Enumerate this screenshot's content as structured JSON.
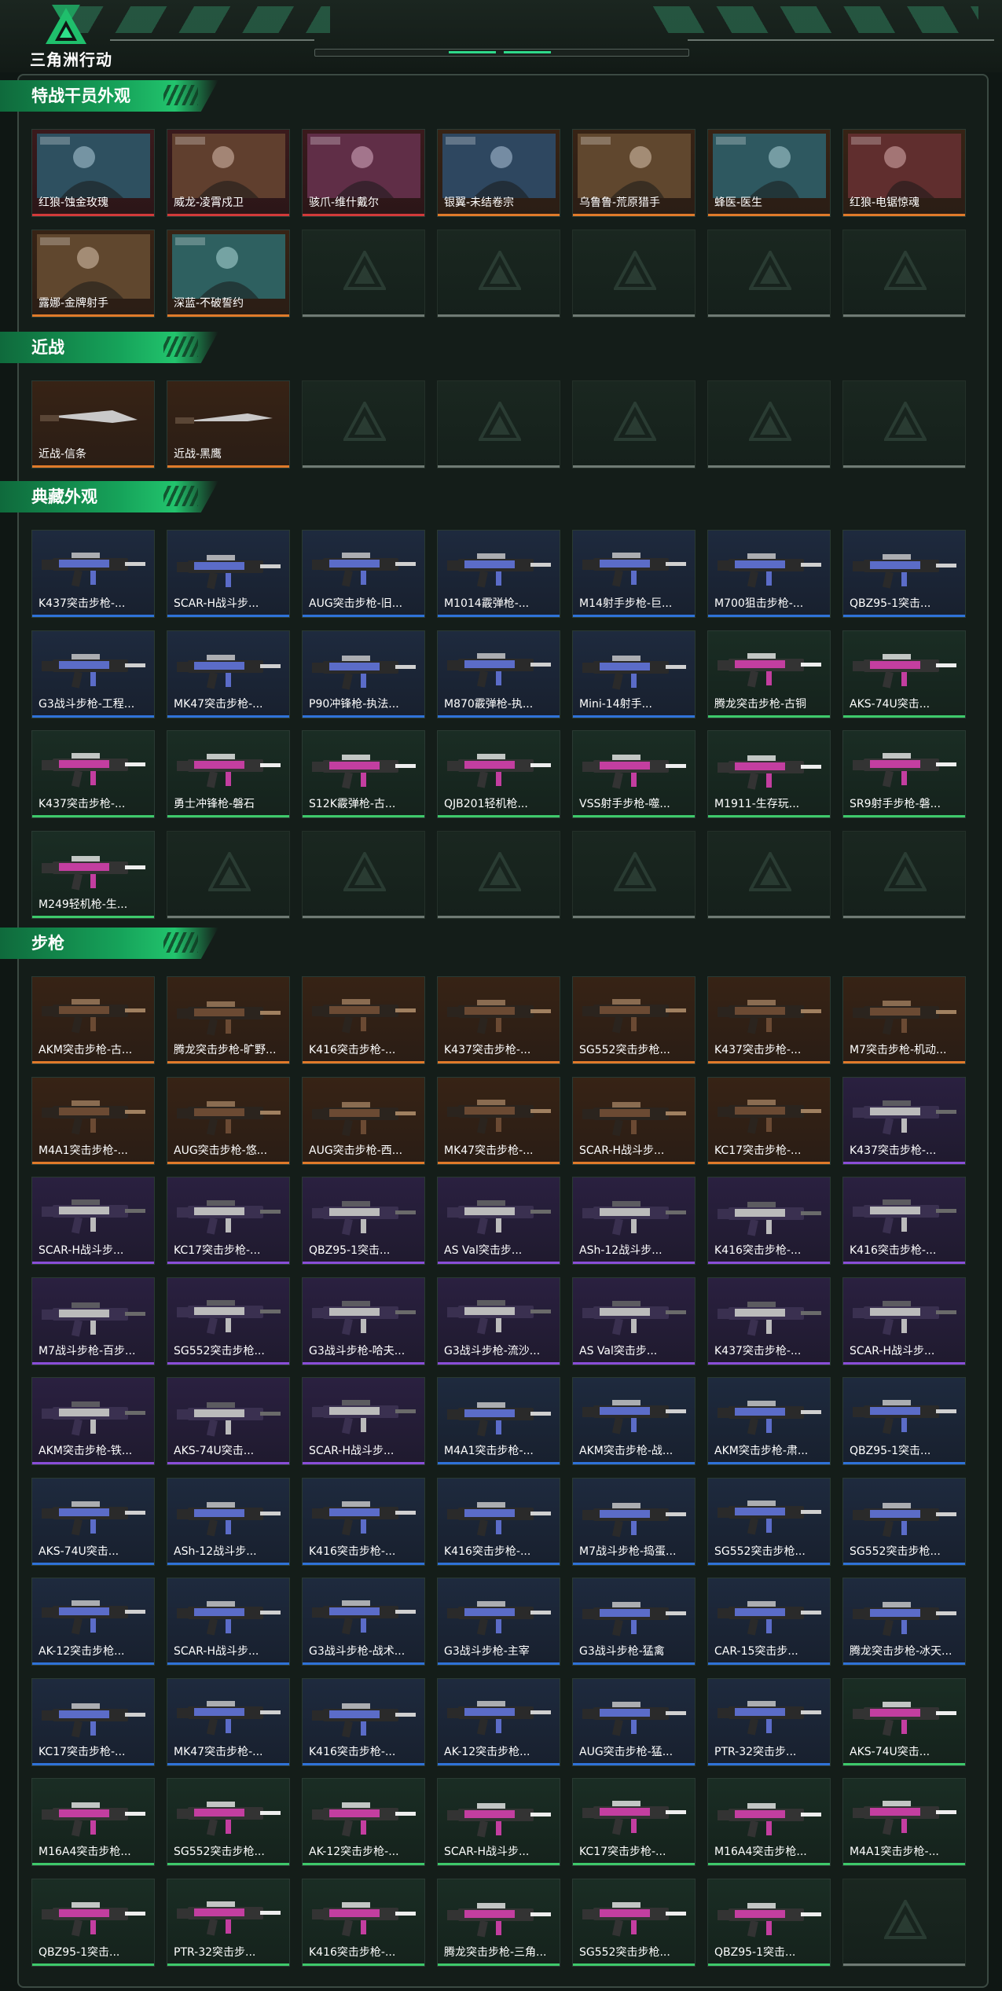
{
  "header": {
    "logo_text": "三角洲行动"
  },
  "colors": {
    "accent": "#22c46d",
    "gold": "#e07a2a",
    "red": "#d23a3a",
    "purple": "#8a4ed8",
    "blue": "#2f72d8",
    "green": "#3ec96b"
  },
  "sections": [
    {
      "title": "特战干员外观",
      "items": [
        {
          "name": "红狼-蚀金玫瑰",
          "rarity": "red"
        },
        {
          "name": "威龙-凌霄戍卫",
          "rarity": "red"
        },
        {
          "name": "骇爪-维什戴尔",
          "rarity": "red"
        },
        {
          "name": "银翼-未结卷宗",
          "rarity": "gold"
        },
        {
          "name": "乌鲁鲁-荒原猎手",
          "rarity": "gold"
        },
        {
          "name": "蜂医-医生",
          "rarity": "gold"
        },
        {
          "name": "红狼-电锯惊魂",
          "rarity": "gold"
        },
        {
          "name": "露娜-金牌射手",
          "rarity": "gold"
        },
        {
          "name": "深蓝-不破誓约",
          "rarity": "gold"
        }
      ],
      "empty_slots": 5
    },
    {
      "title": "近战",
      "items": [
        {
          "name": "近战-信条",
          "rarity": "gold"
        },
        {
          "name": "近战-黑鹰",
          "rarity": "gold"
        }
      ],
      "empty_slots": 5
    },
    {
      "title": "典藏外观",
      "items": [
        {
          "name": "K437突击步枪-...",
          "rarity": "blue"
        },
        {
          "name": "SCAR-H战斗步...",
          "rarity": "blue"
        },
        {
          "name": "AUG突击步枪-旧...",
          "rarity": "blue"
        },
        {
          "name": "M1014霰弹枪-...",
          "rarity": "blue"
        },
        {
          "name": "M14射手步枪-巨...",
          "rarity": "blue"
        },
        {
          "name": "M700狙击步枪-...",
          "rarity": "blue"
        },
        {
          "name": "QBZ95-1突击...",
          "rarity": "blue"
        },
        {
          "name": "G3战斗步枪-工程...",
          "rarity": "blue"
        },
        {
          "name": "MK47突击步枪-...",
          "rarity": "blue"
        },
        {
          "name": "P90冲锋枪-执法...",
          "rarity": "blue"
        },
        {
          "name": "M870霰弹枪-执...",
          "rarity": "blue"
        },
        {
          "name": "Mini-14射手...",
          "rarity": "blue"
        },
        {
          "name": "腾龙突击步枪-古铜",
          "rarity": "green"
        },
        {
          "name": "AKS-74U突击...",
          "rarity": "green"
        },
        {
          "name": "K437突击步枪-...",
          "rarity": "green"
        },
        {
          "name": "勇士冲锋枪-磐石",
          "rarity": "green"
        },
        {
          "name": "S12K霰弹枪-古...",
          "rarity": "green"
        },
        {
          "name": "QJB201轻机枪...",
          "rarity": "green"
        },
        {
          "name": "VSS射手步枪-噬...",
          "rarity": "green"
        },
        {
          "name": "M1911-生存玩...",
          "rarity": "green"
        },
        {
          "name": "SR9射手步枪-磐...",
          "rarity": "green"
        },
        {
          "name": "M249轻机枪-生...",
          "rarity": "green"
        }
      ],
      "empty_slots": 6
    },
    {
      "title": "步枪",
      "items": [
        {
          "name": "AKM突击步枪-古...",
          "rarity": "gold"
        },
        {
          "name": "腾龙突击步枪-旷野...",
          "rarity": "gold"
        },
        {
          "name": "K416突击步枪-...",
          "rarity": "gold"
        },
        {
          "name": "K437突击步枪-...",
          "rarity": "gold"
        },
        {
          "name": "SG552突击步枪...",
          "rarity": "gold"
        },
        {
          "name": "K437突击步枪-...",
          "rarity": "gold"
        },
        {
          "name": "M7突击步枪-机动...",
          "rarity": "gold"
        },
        {
          "name": "M4A1突击步枪-...",
          "rarity": "gold"
        },
        {
          "name": "AUG突击步枪-悠...",
          "rarity": "gold"
        },
        {
          "name": "AUG突击步枪-西...",
          "rarity": "gold"
        },
        {
          "name": "MK47突击步枪-...",
          "rarity": "gold"
        },
        {
          "name": "SCAR-H战斗步...",
          "rarity": "gold"
        },
        {
          "name": "KC17突击步枪-...",
          "rarity": "gold"
        },
        {
          "name": "K437突击步枪-...",
          "rarity": "purple"
        },
        {
          "name": "SCAR-H战斗步...",
          "rarity": "purple"
        },
        {
          "name": "KC17突击步枪-...",
          "rarity": "purple"
        },
        {
          "name": "QBZ95-1突击...",
          "rarity": "purple"
        },
        {
          "name": "AS Val突击步...",
          "rarity": "purple"
        },
        {
          "name": "ASh-12战斗步...",
          "rarity": "purple"
        },
        {
          "name": "K416突击步枪-...",
          "rarity": "purple"
        },
        {
          "name": "K416突击步枪-...",
          "rarity": "purple"
        },
        {
          "name": "M7战斗步枪-百步...",
          "rarity": "purple"
        },
        {
          "name": "SG552突击步枪...",
          "rarity": "purple"
        },
        {
          "name": "G3战斗步枪-哈夫...",
          "rarity": "purple"
        },
        {
          "name": "G3战斗步枪-流沙...",
          "rarity": "purple"
        },
        {
          "name": "AS Val突击步...",
          "rarity": "purple"
        },
        {
          "name": "K437突击步枪-...",
          "rarity": "purple"
        },
        {
          "name": "SCAR-H战斗步...",
          "rarity": "purple"
        },
        {
          "name": "AKM突击步枪-铁...",
          "rarity": "purple"
        },
        {
          "name": "AKS-74U突击...",
          "rarity": "purple"
        },
        {
          "name": "SCAR-H战斗步...",
          "rarity": "purple"
        },
        {
          "name": "M4A1突击步枪-...",
          "rarity": "blue"
        },
        {
          "name": "AKM突击步枪-战...",
          "rarity": "blue"
        },
        {
          "name": "AKM突击步枪-肃...",
          "rarity": "blue"
        },
        {
          "name": "QBZ95-1突击...",
          "rarity": "blue"
        },
        {
          "name": "AKS-74U突击...",
          "rarity": "blue"
        },
        {
          "name": "ASh-12战斗步...",
          "rarity": "blue"
        },
        {
          "name": "K416突击步枪-...",
          "rarity": "blue"
        },
        {
          "name": "K416突击步枪-...",
          "rarity": "blue"
        },
        {
          "name": "M7战斗步枪-捣蛋...",
          "rarity": "blue"
        },
        {
          "name": "SG552突击步枪...",
          "rarity": "blue"
        },
        {
          "name": "SG552突击步枪...",
          "rarity": "blue"
        },
        {
          "name": "AK-12突击步枪...",
          "rarity": "blue"
        },
        {
          "name": "SCAR-H战斗步...",
          "rarity": "blue"
        },
        {
          "name": "G3战斗步枪-战术...",
          "rarity": "blue"
        },
        {
          "name": "G3战斗步枪-主宰",
          "rarity": "blue"
        },
        {
          "name": "G3战斗步枪-猛禽",
          "rarity": "blue"
        },
        {
          "name": "CAR-15突击步...",
          "rarity": "blue"
        },
        {
          "name": "腾龙突击步枪-冰天...",
          "rarity": "blue"
        },
        {
          "name": "KC17突击步枪-...",
          "rarity": "blue"
        },
        {
          "name": "MK47突击步枪-...",
          "rarity": "blue"
        },
        {
          "name": "K416突击步枪-...",
          "rarity": "blue"
        },
        {
          "name": "AK-12突击步枪...",
          "rarity": "blue"
        },
        {
          "name": "AUG突击步枪-猛...",
          "rarity": "blue"
        },
        {
          "name": "PTR-32突击步...",
          "rarity": "blue"
        },
        {
          "name": "AKS-74U突击...",
          "rarity": "green"
        },
        {
          "name": "M16A4突击步枪...",
          "rarity": "green"
        },
        {
          "name": "SG552突击步枪...",
          "rarity": "green"
        },
        {
          "name": "AK-12突击步枪-...",
          "rarity": "green"
        },
        {
          "name": "SCAR-H战斗步...",
          "rarity": "green"
        },
        {
          "name": "KC17突击步枪-...",
          "rarity": "green"
        },
        {
          "name": "M16A4突击步枪...",
          "rarity": "green"
        },
        {
          "name": "M4A1突击步枪-...",
          "rarity": "green"
        },
        {
          "name": "QBZ95-1突击...",
          "rarity": "green"
        },
        {
          "name": "PTR-32突击步...",
          "rarity": "green"
        },
        {
          "name": "K416突击步枪-...",
          "rarity": "green"
        },
        {
          "name": "腾龙突击步枪-三角...",
          "rarity": "green"
        },
        {
          "name": "SG552突击步枪...",
          "rarity": "green"
        },
        {
          "name": "QBZ95-1突击...",
          "rarity": "green"
        }
      ],
      "empty_slots": 1
    }
  ]
}
